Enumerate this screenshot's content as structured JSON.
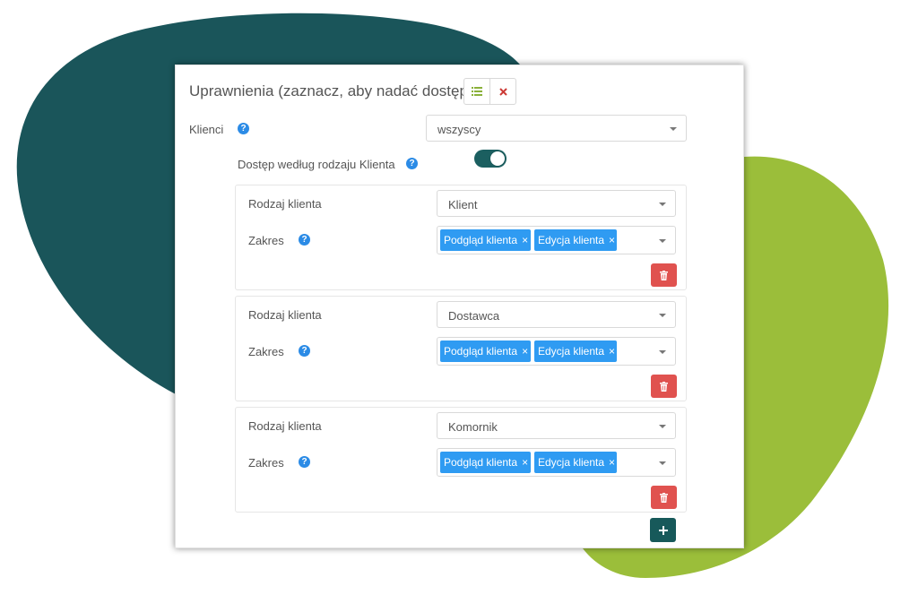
{
  "colors": {
    "blob_dark": "#1a555a",
    "blob_green": "#9bbe3a",
    "tag_blue": "#2f9bf2",
    "danger": "#e0524f",
    "primary": "#17595a",
    "help_blue": "#2b8be6"
  },
  "panel": {
    "title": "Uprawnienia (zaznacz, aby nadać dostęp):",
    "title_buttons": [
      {
        "icon": "checklist-icon"
      },
      {
        "icon": "close-icon"
      }
    ]
  },
  "clients": {
    "label": "Klienci",
    "help_icon": "help-icon",
    "selected": "wszyscy"
  },
  "by_type": {
    "label": "Dostęp według rodzaju Klienta",
    "help_icon": "help-icon",
    "enabled": true
  },
  "groups": [
    {
      "type_label": "Rodzaj klienta",
      "type_value": "Klient",
      "scope_label": "Zakres",
      "tags": [
        "Podgląd klienta",
        "Edycja klienta"
      ],
      "tag_remove": "×"
    },
    {
      "type_label": "Rodzaj klienta",
      "type_value": "Dostawca",
      "scope_label": "Zakres",
      "tags": [
        "Podgląd klienta",
        "Edycja klienta"
      ],
      "tag_remove": "×"
    },
    {
      "type_label": "Rodzaj klienta",
      "type_value": "Komornik",
      "scope_label": "Zakres",
      "tags": [
        "Podgląd klienta",
        "Edycja klienta"
      ],
      "tag_remove": "×"
    }
  ],
  "actions": {
    "delete_icon": "trash-icon",
    "add_label": "+"
  }
}
